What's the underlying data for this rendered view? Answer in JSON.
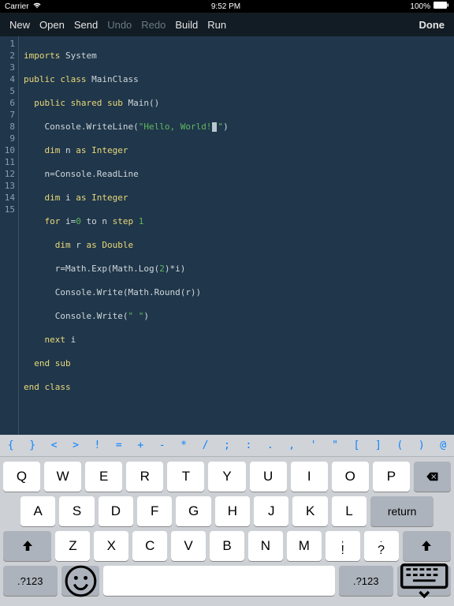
{
  "status": {
    "carrier": "Carrier",
    "time": "9:52 PM",
    "battery": "100%"
  },
  "toolbar": {
    "new": "New",
    "open": "Open",
    "send": "Send",
    "undo": "Undo",
    "redo": "Redo",
    "build": "Build",
    "run": "Run",
    "done": "Done"
  },
  "lineNumbers": [
    "1",
    "2",
    "3",
    "4",
    "5",
    "6",
    "7",
    "8",
    "9",
    "10",
    "11",
    "12",
    "13",
    "14",
    "15"
  ],
  "code": {
    "l1a": "imports",
    "l1b": " System",
    "l2a": "public class",
    "l2b": " MainClass",
    "l3a": "public shared sub",
    "l3b": " Main()",
    "l4a": "Console.WriteLine(",
    "l4s": "\"Hello, World!",
    "l4s2": "\"",
    "l4b": ")",
    "l5a": "dim",
    "l5b": " n ",
    "l5c": "as Integer",
    "l6": "n=Console.ReadLine",
    "l7a": "dim",
    "l7b": " i ",
    "l7c": "as Integer",
    "l8a": "for",
    "l8b": " i=",
    "l8n1": "0",
    "l8c": " to n ",
    "l8d": "step",
    "l8e": " ",
    "l8n2": "1",
    "l9a": "dim",
    "l9b": " r ",
    "l9c": "as Double",
    "l10a": "r=Math.Exp(Math.Log(",
    "l10n": "2",
    "l10b": ")*i)",
    "l11": "Console.Write(Math.Round(r))",
    "l12a": "Console.Write(",
    "l12s": "\" \"",
    "l12b": ")",
    "l13a": "next",
    "l13b": " i",
    "l14": "end sub",
    "l15": "end class"
  },
  "symbols": [
    "{",
    "}",
    "<",
    ">",
    "!",
    "=",
    "+",
    "-",
    "*",
    "/",
    ";",
    ":",
    ".",
    ",",
    "'",
    "\"",
    "[",
    "]",
    "(",
    ")",
    "@"
  ],
  "keys": {
    "row1": [
      "Q",
      "W",
      "E",
      "R",
      "T",
      "Y",
      "U",
      "I",
      "O",
      "P"
    ],
    "row2": [
      "A",
      "S",
      "D",
      "F",
      "G",
      "H",
      "J",
      "K",
      "L"
    ],
    "row3": [
      "Z",
      "X",
      "C",
      "V",
      "B",
      "N",
      "M"
    ],
    "punct1top": ",",
    "punct1main": "!",
    "punct2top": ".",
    "punct2main": "?",
    "numkey": ".?123",
    "return": "return"
  }
}
